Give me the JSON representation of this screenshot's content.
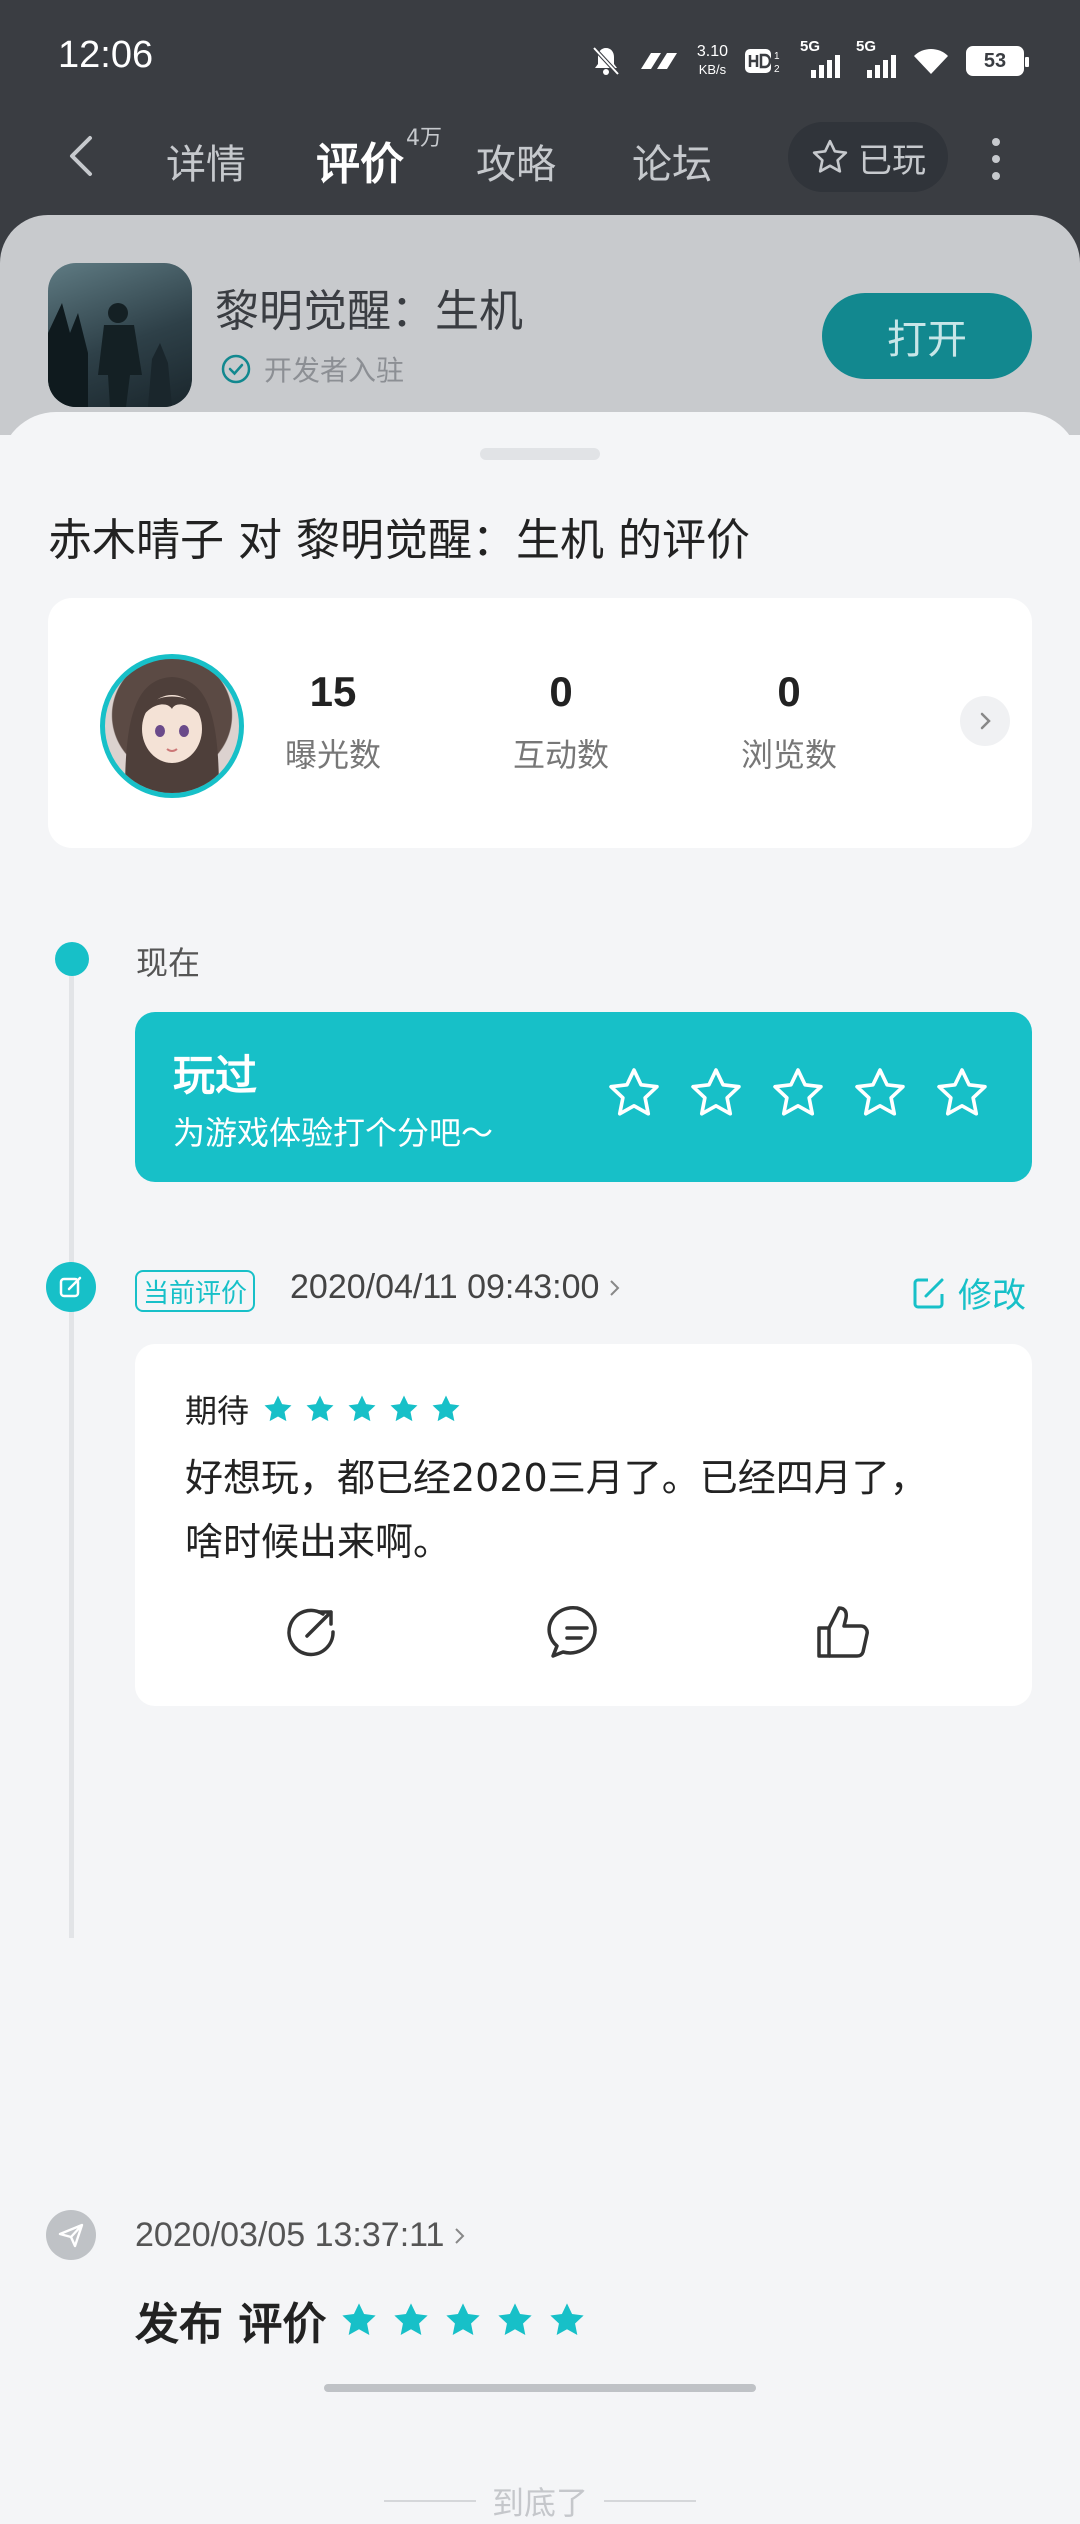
{
  "status_bar": {
    "time": "12:06",
    "net_speed_value": "3.10",
    "net_speed_unit": "KB/s",
    "battery": "53",
    "icons": [
      "mute-icon",
      "nfc-icon",
      "hd-icon",
      "signal-5g-icon",
      "signal-5g-icon",
      "wifi-icon",
      "battery-icon"
    ]
  },
  "nav": {
    "tabs": [
      {
        "label": "详情"
      },
      {
        "label": "评价"
      },
      {
        "label": "攻略"
      },
      {
        "label": "论坛"
      }
    ],
    "review_count_badge": "4万",
    "played_label": "已玩"
  },
  "app": {
    "name": "黎明觉醒：生机",
    "verified_label": "开发者入驻",
    "open_button": "打开"
  },
  "sheet": {
    "heading": "赤木晴子 对 黎明觉醒：生机 的评价",
    "stats": [
      {
        "value": "15",
        "label": "曝光数"
      },
      {
        "value": "0",
        "label": "互动数"
      },
      {
        "value": "0",
        "label": "浏览数"
      }
    ],
    "timeline": {
      "now_label": "现在",
      "rate_card": {
        "title": "玩过",
        "subtitle": "为游戏体验打个分吧～"
      },
      "current_review": {
        "badge": "当前评价",
        "datetime": "2020/04/11 09:43:00",
        "edit_label": "修改",
        "tag": "期待",
        "rating": 5,
        "text": "好想玩，都已经2020三月了。已经四月了，啥时候出来啊。"
      },
      "first_review": {
        "datetime": "2020/03/05 13:37:11",
        "label": "发布 评价",
        "rating": 5
      }
    },
    "end_label": "到底了"
  },
  "colors": {
    "accent": "#17c0c8",
    "header_bg": "#3a3d42",
    "sheet_bg": "#f4f5f7"
  }
}
